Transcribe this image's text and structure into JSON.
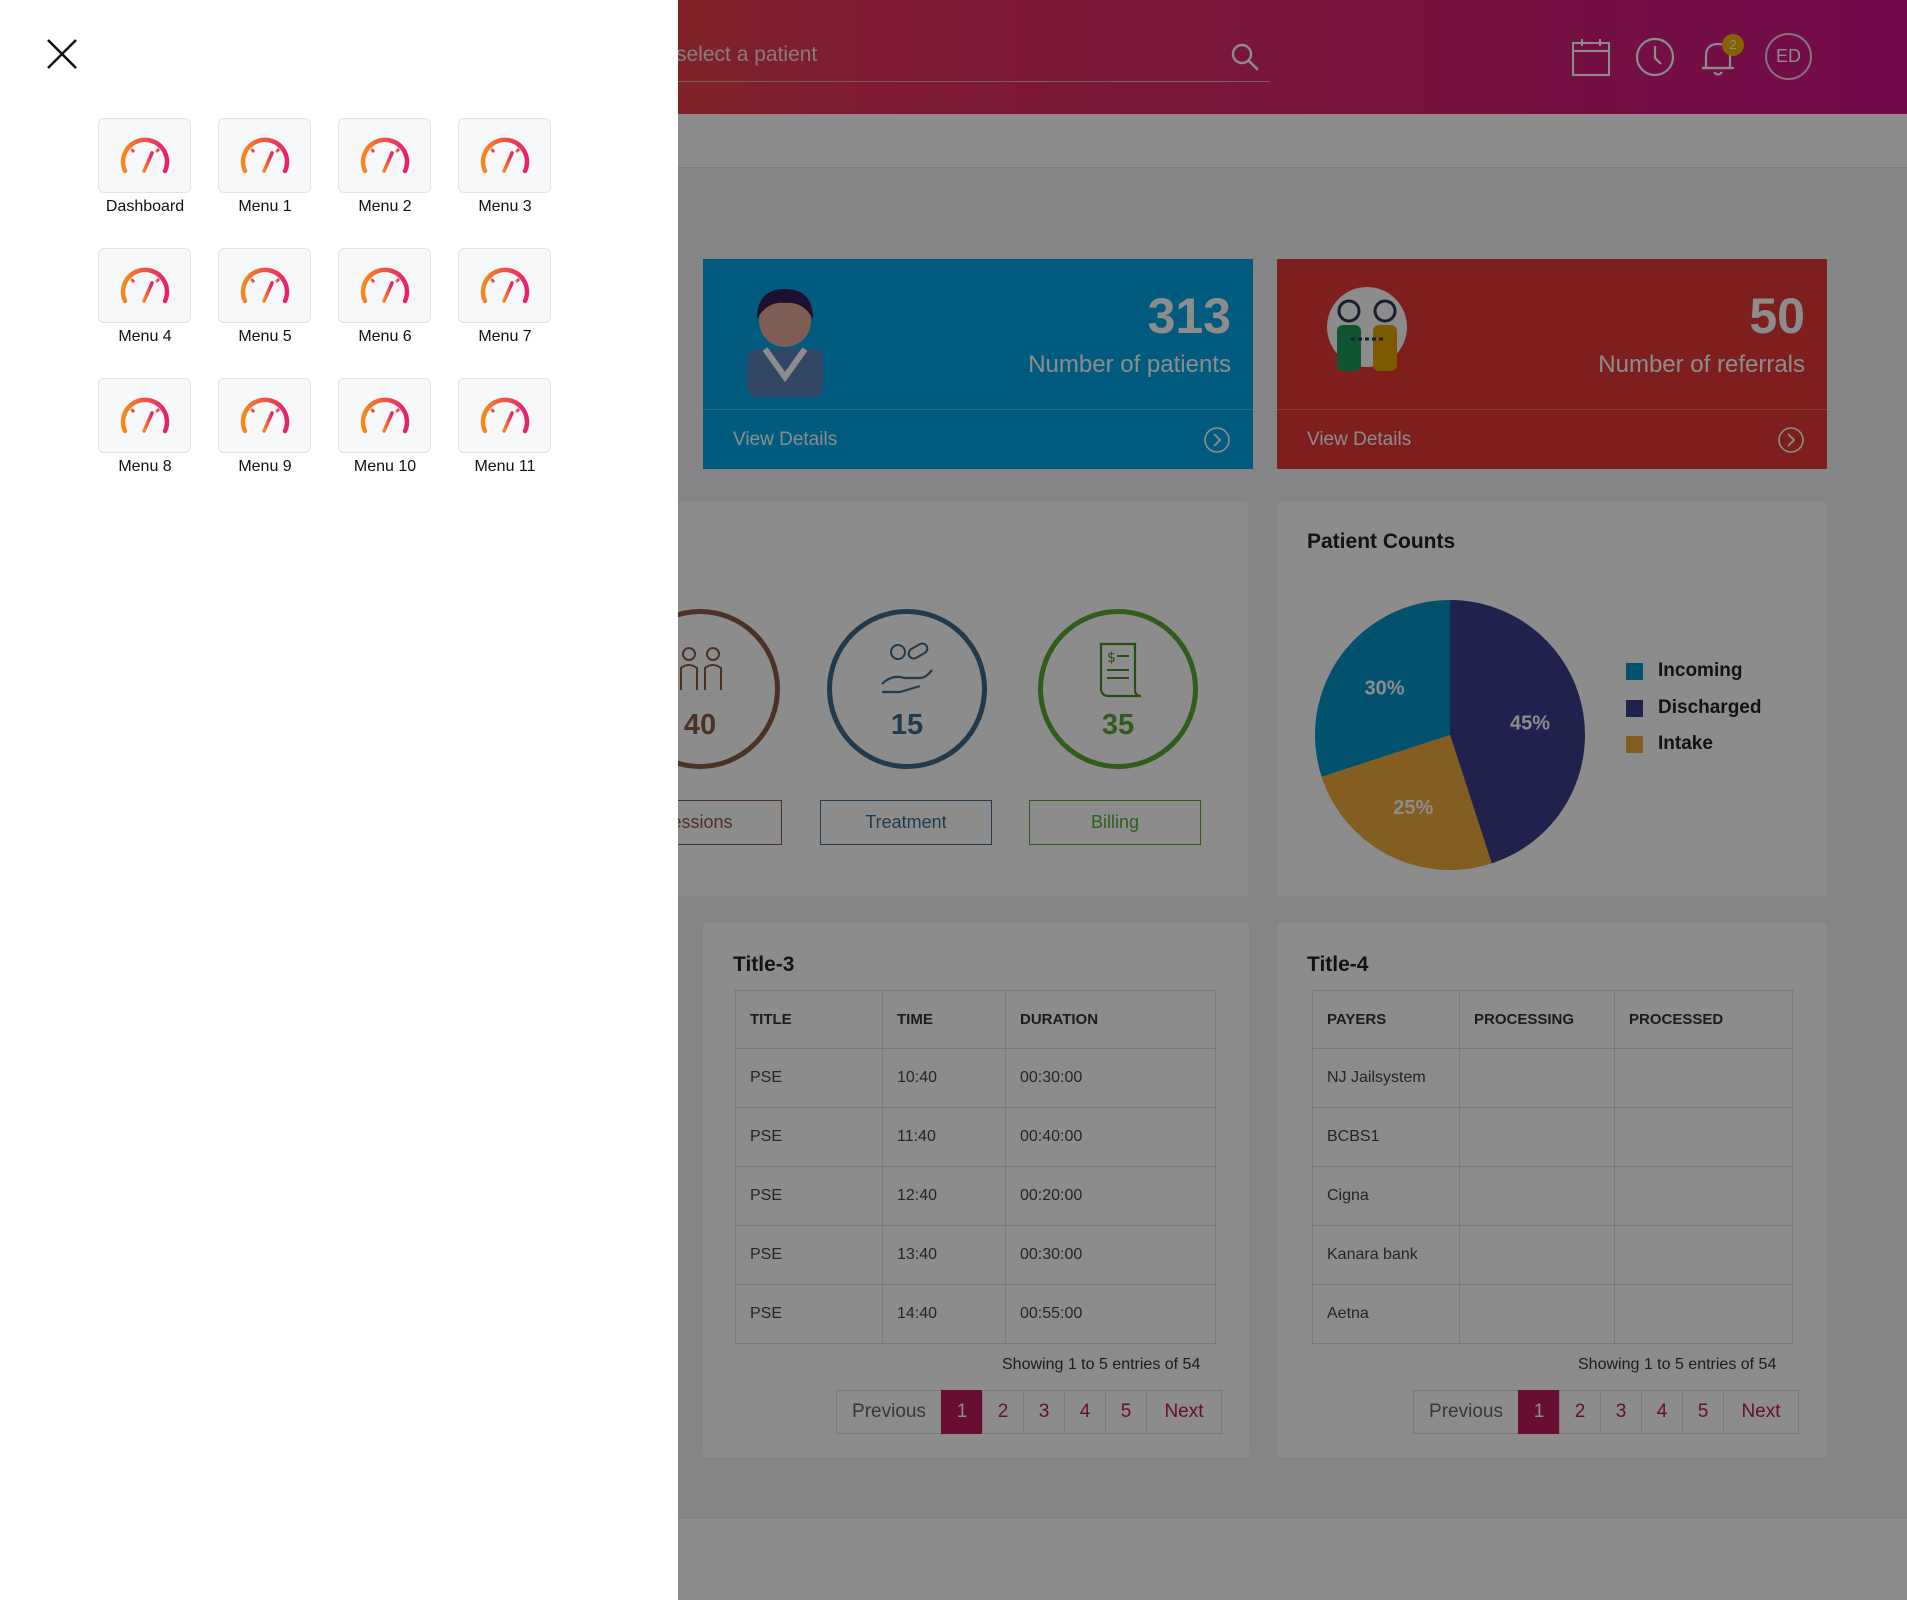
{
  "header": {
    "search_placeholder": "select a patient",
    "notification_count": "2",
    "user_initials": "ED"
  },
  "stats": [
    {
      "value": "313",
      "label": "Number of patients",
      "footer": "View Details",
      "color": "#00a6e6"
    },
    {
      "value": "50",
      "label": "Number of referrals",
      "footer": "View Details",
      "color": "#e53935"
    }
  ],
  "counters": [
    {
      "value": "40",
      "button": "Sessions",
      "color": "#8a5a48"
    },
    {
      "value": "15",
      "button": "Treatment",
      "color": "#3e6b8a"
    },
    {
      "value": "35",
      "button": "Billing",
      "color": "#5aa832"
    }
  ],
  "chart_data": {
    "type": "pie",
    "title": "Patient Counts",
    "categories": [
      "Incoming",
      "Discharged",
      "Intake"
    ],
    "values": [
      30,
      45,
      25
    ],
    "labels": [
      "30%",
      "45%",
      "25%"
    ],
    "colors": [
      "#0596c8",
      "#3d3c8c",
      "#eeab3b"
    ],
    "legend": "right"
  },
  "table3": {
    "title": "Title-3",
    "columns": [
      "TITLE",
      "TIME",
      "DURATION"
    ],
    "rows": [
      [
        "PSE",
        "10:40",
        "00:30:00"
      ],
      [
        "PSE",
        "11:40",
        "00:40:00"
      ],
      [
        "PSE",
        "12:40",
        "00:20:00"
      ],
      [
        "PSE",
        "13:40",
        "00:30:00"
      ],
      [
        "PSE",
        "14:40",
        "00:55:00"
      ]
    ],
    "entries": "Showing 1 to 5 entries of 54"
  },
  "table4": {
    "title": "Title-4",
    "columns": [
      "PAYERS",
      "PROCESSING",
      "PROCESSED"
    ],
    "rows": [
      [
        "NJ Jailsystem",
        "",
        ""
      ],
      [
        "BCBS1",
        "",
        ""
      ],
      [
        "Cigna",
        "",
        ""
      ],
      [
        "Kanara bank",
        "",
        ""
      ],
      [
        "Aetna",
        "",
        ""
      ]
    ],
    "entries": "Showing 1 to 5 entries of 54"
  },
  "pager": {
    "previous": "Previous",
    "pages": [
      "1",
      "2",
      "3",
      "4",
      "5"
    ],
    "next": "Next",
    "active": "1"
  },
  "drawer": {
    "items": [
      "Dashboard",
      "Menu 1",
      "Menu 2",
      "Menu 3",
      "Menu 4",
      "Menu 5",
      "Menu 6",
      "Menu 7",
      "Menu 8",
      "Menu 9",
      "Menu 10",
      "Menu 11"
    ]
  }
}
